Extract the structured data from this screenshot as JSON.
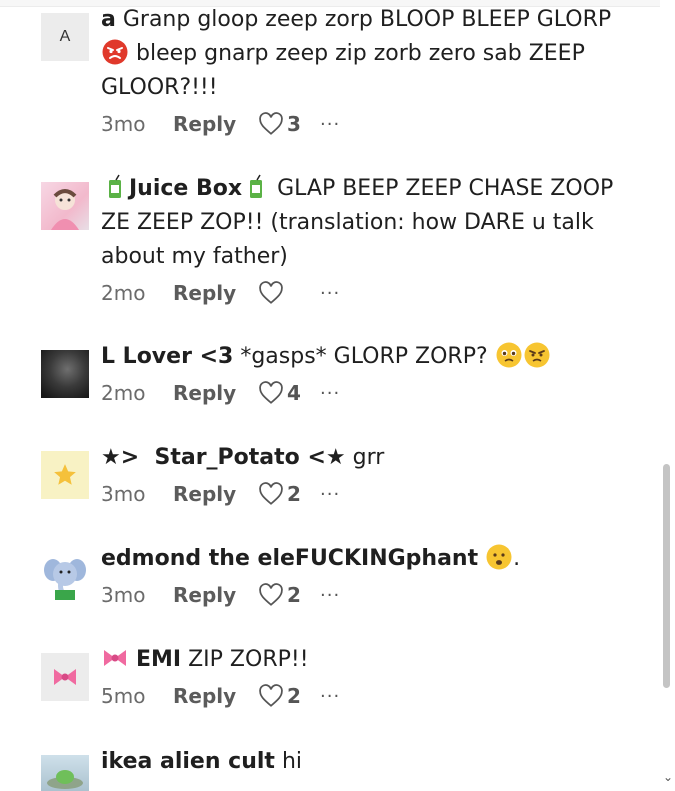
{
  "comments": [
    {
      "avatar_letter": "A",
      "author": "a",
      "text": "Granp gloop zeep zorp BLOOP BLEEP GLORP",
      "text_tail": "bleep gnarp zeep zip zorb zero sab ZEEP GLOOR?!!!",
      "time": "3mo",
      "reply": "Reply",
      "likes": "3",
      "more": "···"
    },
    {
      "author": "Juice Box",
      "text": "GLAP BEEP ZEEP CHASE ZOOP ZE ZEEP ZOP!! (translation: how DARE u talk about my father)",
      "time": "2mo",
      "reply": "Reply",
      "likes": "",
      "more": "···"
    },
    {
      "author": "L Lover <3",
      "text": "*gasps* GLORP ZORP?",
      "time": "2mo",
      "reply": "Reply",
      "likes": "4",
      "more": "···"
    },
    {
      "author_prefix": "★>",
      "author": "Star_Potato",
      "author_suffix": "<★",
      "text": "grr",
      "time": "3mo",
      "reply": "Reply",
      "likes": "2",
      "more": "···"
    },
    {
      "author": "edmond the eleFUCKINGphant",
      "text": ".",
      "time": "3mo",
      "reply": "Reply",
      "likes": "2",
      "more": "···"
    },
    {
      "author": "EMI",
      "text": "ZIP ZORP!!",
      "time": "5mo",
      "reply": "Reply",
      "likes": "2",
      "more": "···"
    },
    {
      "author": "ikea alien cult",
      "text": "hi"
    }
  ],
  "icons": {
    "like": "heart-outline-icon",
    "more": "more-dots-icon"
  },
  "colors": {
    "text": "#1f1f1f",
    "meta": "#6b6b6b",
    "thumb": "#c4c4c4"
  }
}
